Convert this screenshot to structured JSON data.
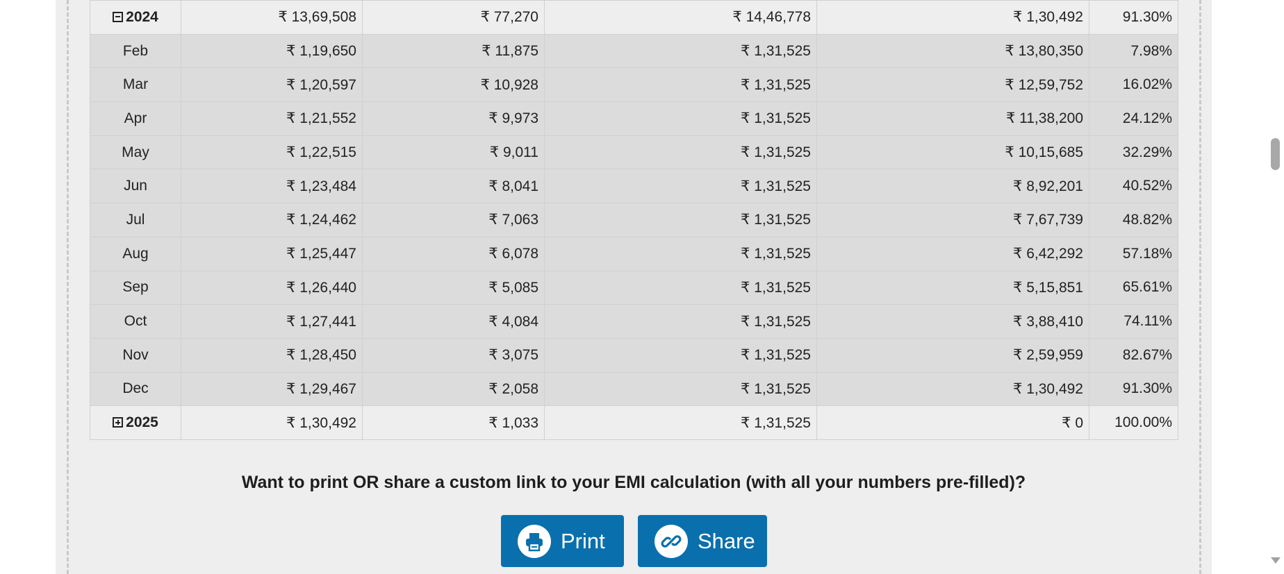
{
  "schedule": {
    "rows": [
      {
        "kind": "year",
        "expanded": true,
        "period": "2024",
        "principal": "₹ 13,69,508",
        "interest": "₹ 77,270",
        "total": "₹ 14,46,778",
        "balance": "₹ 1,30,492",
        "paid": "91.30%"
      },
      {
        "kind": "month",
        "period": "Feb",
        "principal": "₹ 1,19,650",
        "interest": "₹ 11,875",
        "total": "₹ 1,31,525",
        "balance": "₹ 13,80,350",
        "paid": "7.98%"
      },
      {
        "kind": "month",
        "period": "Mar",
        "principal": "₹ 1,20,597",
        "interest": "₹ 10,928",
        "total": "₹ 1,31,525",
        "balance": "₹ 12,59,752",
        "paid": "16.02%"
      },
      {
        "kind": "month",
        "period": "Apr",
        "principal": "₹ 1,21,552",
        "interest": "₹ 9,973",
        "total": "₹ 1,31,525",
        "balance": "₹ 11,38,200",
        "paid": "24.12%"
      },
      {
        "kind": "month",
        "period": "May",
        "principal": "₹ 1,22,515",
        "interest": "₹ 9,011",
        "total": "₹ 1,31,525",
        "balance": "₹ 10,15,685",
        "paid": "32.29%"
      },
      {
        "kind": "month",
        "period": "Jun",
        "principal": "₹ 1,23,484",
        "interest": "₹ 8,041",
        "total": "₹ 1,31,525",
        "balance": "₹ 8,92,201",
        "paid": "40.52%"
      },
      {
        "kind": "month",
        "period": "Jul",
        "principal": "₹ 1,24,462",
        "interest": "₹ 7,063",
        "total": "₹ 1,31,525",
        "balance": "₹ 7,67,739",
        "paid": "48.82%"
      },
      {
        "kind": "month",
        "period": "Aug",
        "principal": "₹ 1,25,447",
        "interest": "₹ 6,078",
        "total": "₹ 1,31,525",
        "balance": "₹ 6,42,292",
        "paid": "57.18%"
      },
      {
        "kind": "month",
        "period": "Sep",
        "principal": "₹ 1,26,440",
        "interest": "₹ 5,085",
        "total": "₹ 1,31,525",
        "balance": "₹ 5,15,851",
        "paid": "65.61%"
      },
      {
        "kind": "month",
        "period": "Oct",
        "principal": "₹ 1,27,441",
        "interest": "₹ 4,084",
        "total": "₹ 1,31,525",
        "balance": "₹ 3,88,410",
        "paid": "74.11%"
      },
      {
        "kind": "month",
        "period": "Nov",
        "principal": "₹ 1,28,450",
        "interest": "₹ 3,075",
        "total": "₹ 1,31,525",
        "balance": "₹ 2,59,959",
        "paid": "82.67%"
      },
      {
        "kind": "month",
        "period": "Dec",
        "principal": "₹ 1,29,467",
        "interest": "₹ 2,058",
        "total": "₹ 1,31,525",
        "balance": "₹ 1,30,492",
        "paid": "91.30%"
      },
      {
        "kind": "year",
        "expanded": false,
        "period": "2025",
        "principal": "₹ 1,30,492",
        "interest": "₹ 1,033",
        "total": "₹ 1,31,525",
        "balance": "₹ 0",
        "paid": "100.00%"
      }
    ]
  },
  "cta": {
    "text": "Want to print OR share a custom link to your EMI calculation (with all your numbers pre-filled)?",
    "print_label": "Print",
    "share_label": "Share",
    "print_icon": "printer-icon",
    "share_icon": "link-icon"
  },
  "colors": {
    "button_bg": "#0a70ad",
    "panel_bg": "#eeeeee",
    "month_row_bg": "#dcdcdc"
  }
}
